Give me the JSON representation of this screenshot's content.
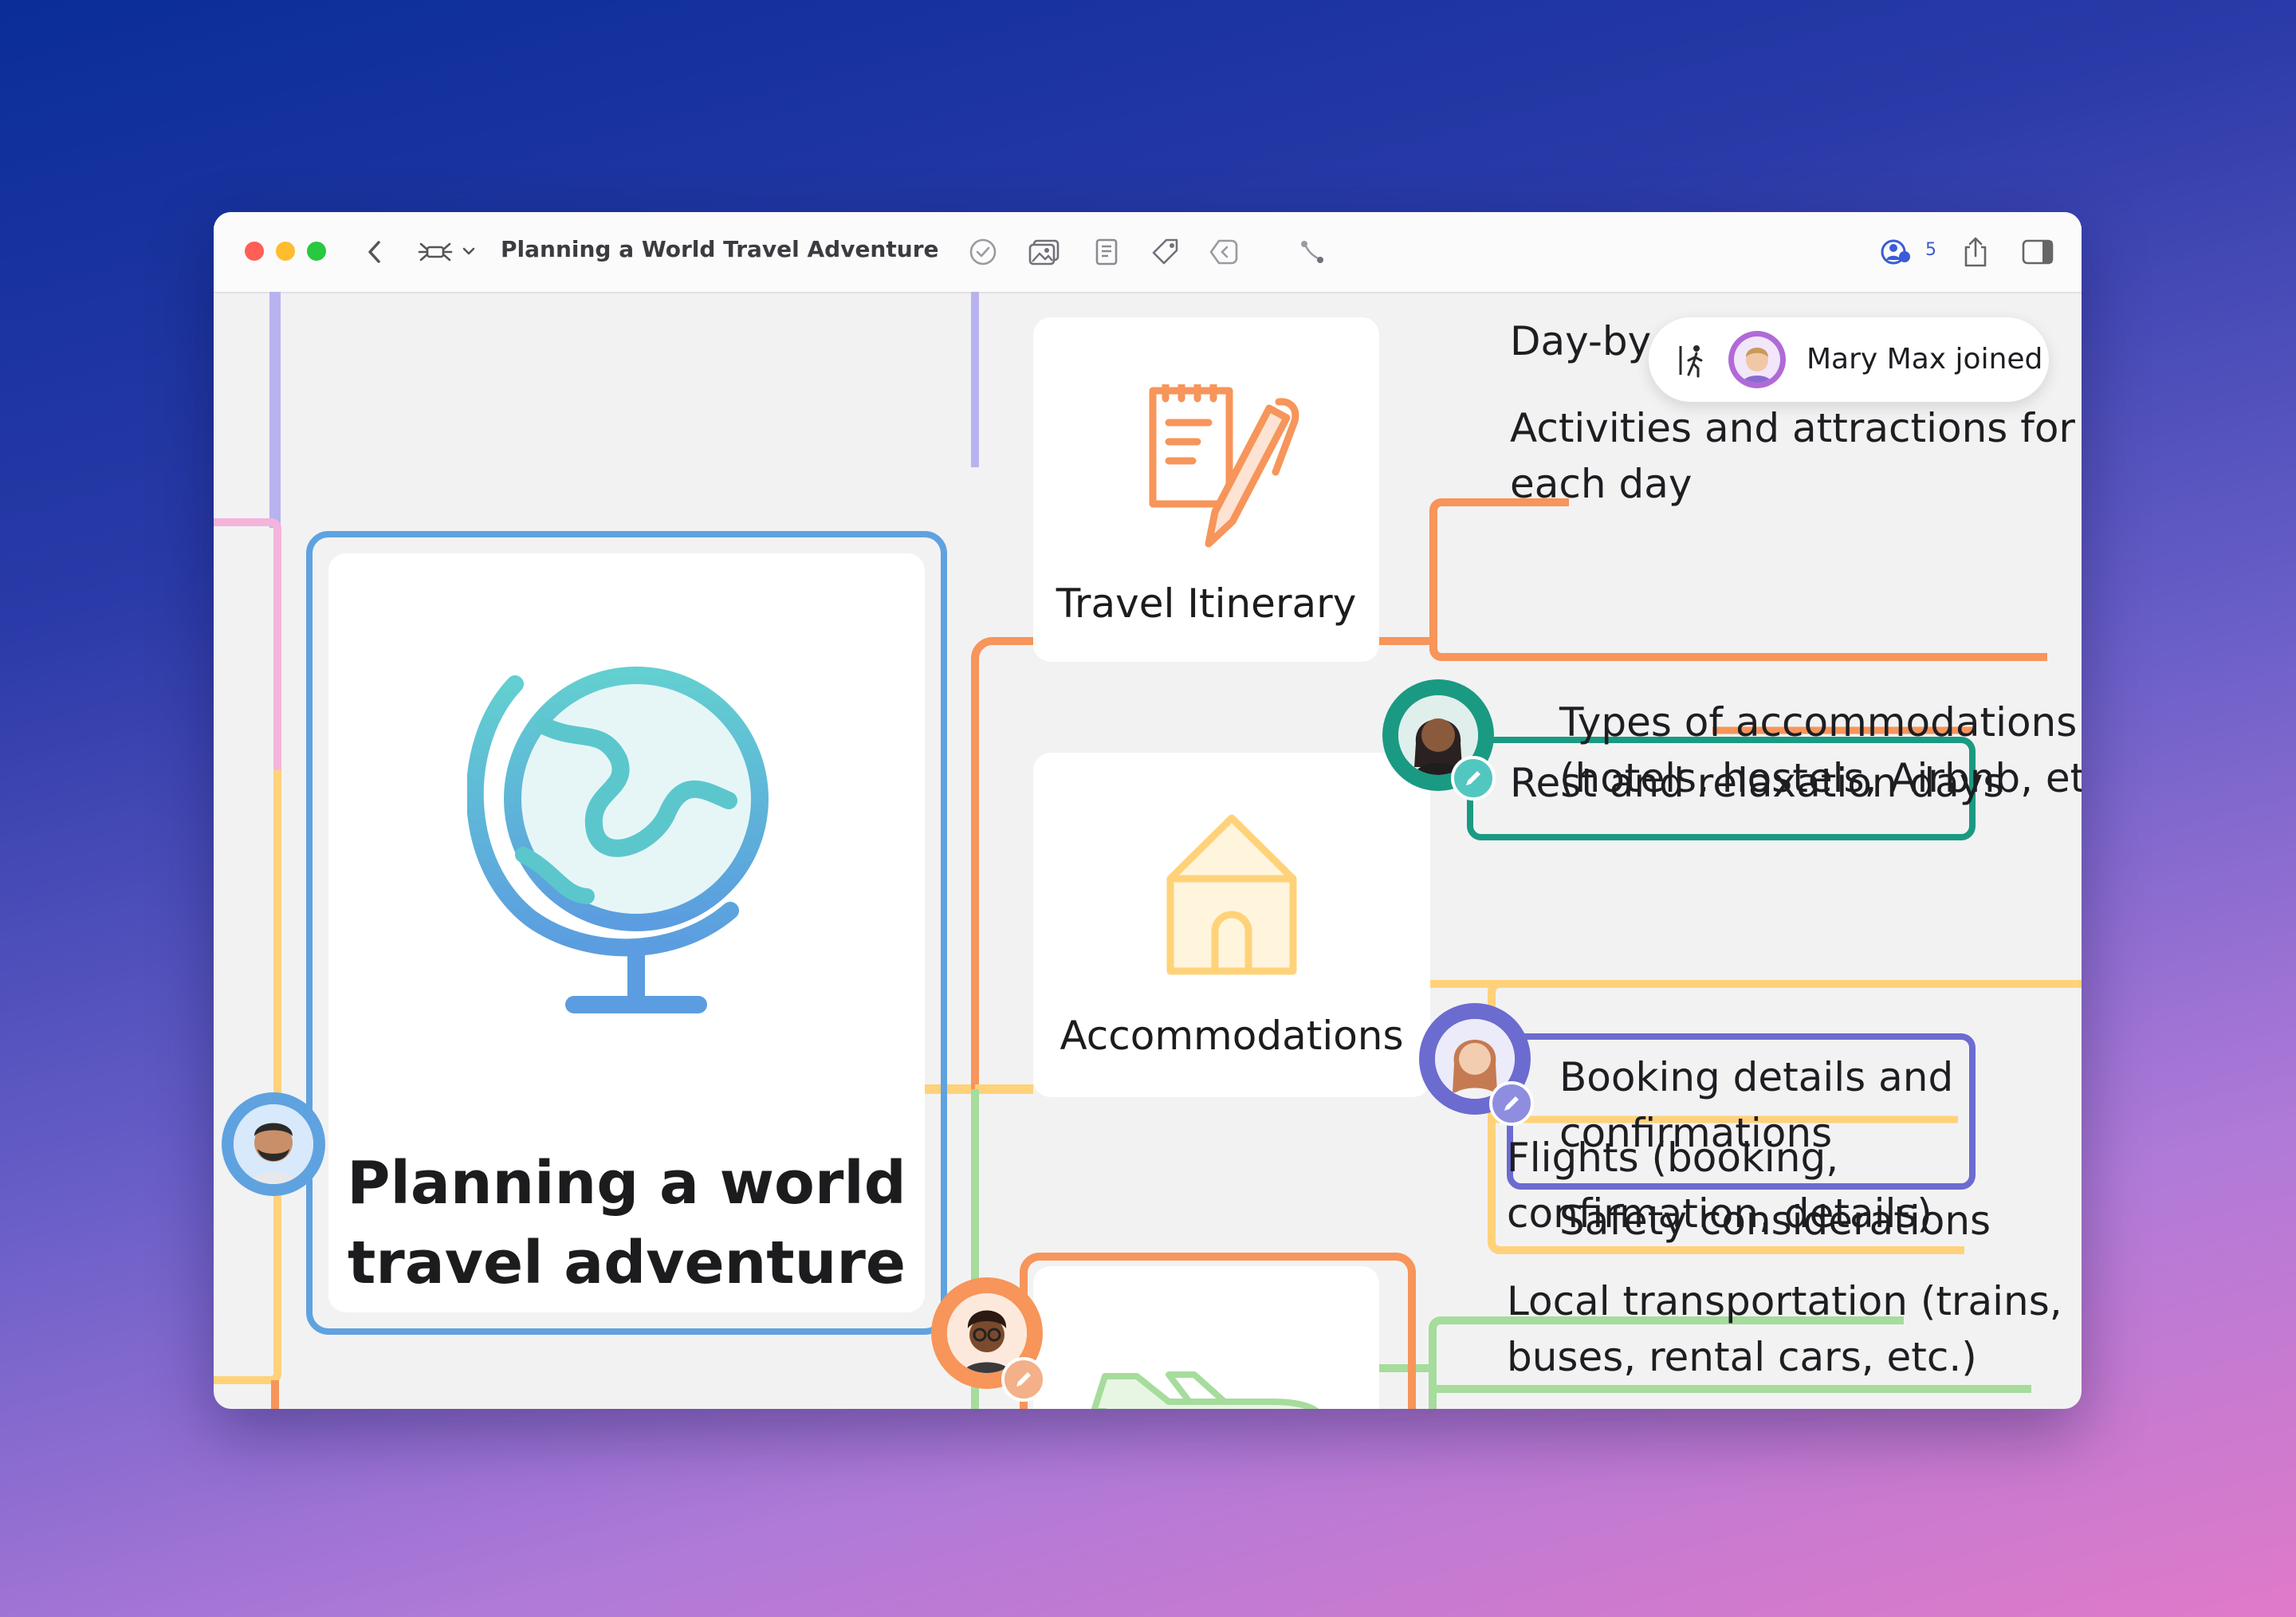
{
  "window": {
    "title": "Planning a World Travel Adventure",
    "collaborator_count": "5"
  },
  "icons": {
    "back": "chevron-left-icon",
    "map_style": "mind-map-icon",
    "task": "checkmark-circle-icon",
    "image": "image-icon",
    "note": "note-icon",
    "tag": "tag-icon",
    "link": "link-icon",
    "relationship": "relationship-icon",
    "collaborate": "collaboration-icon",
    "share": "share-icon",
    "sidebar": "sidebar-icon"
  },
  "toast": {
    "text": "Mary Max joined"
  },
  "central_topic": {
    "title_line1": "Planning a world",
    "title_line2": "travel adventure"
  },
  "topics": {
    "itinerary": {
      "label": "Travel Itinerary",
      "subtopics": {
        "day_by_day": "Day-by-",
        "activities_line1": "Activities and attractions for",
        "activities_line2": "each day",
        "rest": "Rest and relaxation days"
      }
    },
    "accommodations": {
      "label": "Accommodations",
      "subtopics": {
        "types_line1": "Types of accommodations",
        "types_line2": "(hotels, hostels, Airbnb, etc.)",
        "booking_line1": "Booking details and",
        "booking_line2": "confirmations",
        "safety": "Safety considerations"
      }
    },
    "transportation": {
      "subtopics": {
        "flights_line1": "Flights (booking,",
        "flights_line2": "confirmation, details)",
        "local_line1": "Local transportation (trains,",
        "local_line2": "buses, rental cars, etc.)"
      }
    }
  },
  "colors": {
    "orange": "#f7955a",
    "yellow": "#ffd27a",
    "green": "#a6dc9c",
    "teal": "#1a9a82",
    "indigo": "#6c6bd0",
    "blue": "#5fa2e0",
    "lavender": "#b8b3f0",
    "pink": "#f4b4dc"
  }
}
